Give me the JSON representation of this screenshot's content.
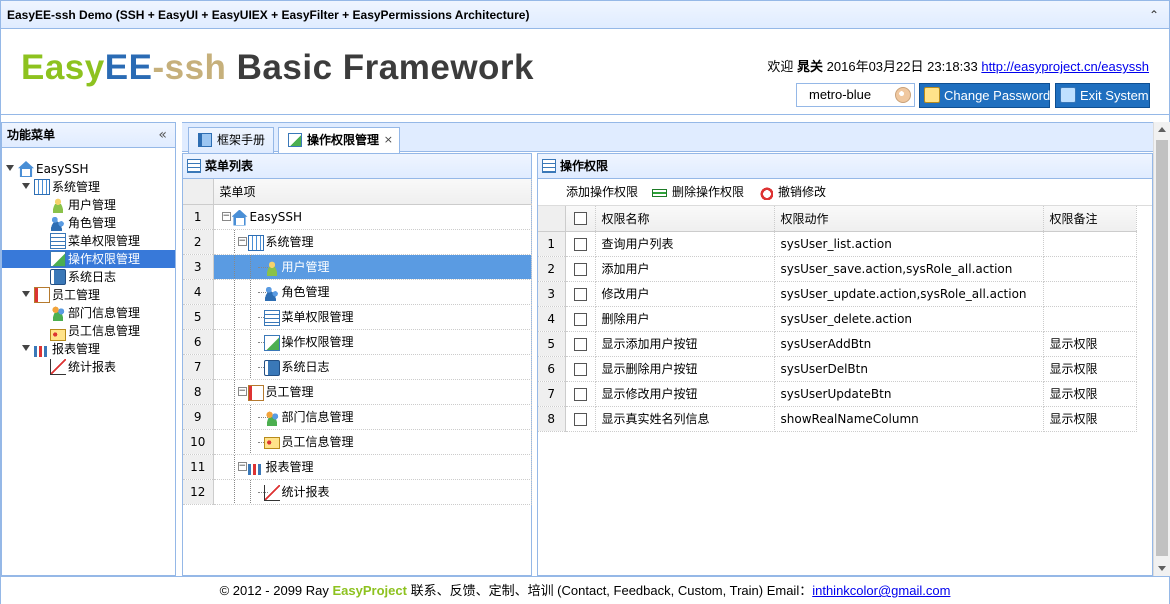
{
  "window": {
    "title": "EasyEE-ssh Demo (SSH + EasyUI + EasyUIEX + EasyFilter + EasyPermissions Architecture)"
  },
  "header": {
    "brand": {
      "part1": "Easy",
      "part2": "EE",
      "part3": "-ssh",
      "part4": " Basic Framework"
    },
    "welcome_prefix": "欢迎",
    "user": "晁关",
    "datetime": "2016年03月22日 23:18:33",
    "site_link": "http://easyproject.cn/easyssh",
    "theme_value": "metro-blue",
    "change_password_label": "Change Password",
    "exit_label": "Exit System"
  },
  "west": {
    "title": "功能菜单",
    "tree": [
      {
        "label": "EasySSH",
        "icon": "home-icon",
        "level": 0
      },
      {
        "label": "系统管理",
        "icon": "grid-icon",
        "level": 1
      },
      {
        "label": "用户管理",
        "icon": "user-icon",
        "level": 2
      },
      {
        "label": "角色管理",
        "icon": "role-icon",
        "level": 2
      },
      {
        "label": "菜单权限管理",
        "icon": "menu-icon",
        "level": 2
      },
      {
        "label": "操作权限管理",
        "icon": "permission-icon",
        "level": 2,
        "selected": true
      },
      {
        "label": "系统日志",
        "icon": "log-icon",
        "level": 2
      },
      {
        "label": "员工管理",
        "icon": "employee-icon",
        "level": 1
      },
      {
        "label": "部门信息管理",
        "icon": "department-icon",
        "level": 2
      },
      {
        "label": "员工信息管理",
        "icon": "card-icon",
        "level": 2
      },
      {
        "label": "报表管理",
        "icon": "chart-icon",
        "level": 1
      },
      {
        "label": "统计报表",
        "icon": "statistics-icon",
        "level": 2
      }
    ]
  },
  "tabs": [
    {
      "label": "框架手册",
      "icon": "book-icon",
      "active": false
    },
    {
      "label": "操作权限管理",
      "icon": "permission-icon",
      "active": true,
      "close": "×"
    }
  ],
  "menu_panel": {
    "title": "菜单列表",
    "column": "菜单项",
    "rows": [
      {
        "n": "1",
        "label": "EasySSH",
        "depth": 0,
        "icon": "home-icon",
        "toggle": "−"
      },
      {
        "n": "2",
        "label": "系统管理",
        "depth": 1,
        "icon": "grid-icon",
        "toggle": "−"
      },
      {
        "n": "3",
        "label": "用户管理",
        "depth": 2,
        "icon": "user-icon",
        "selected": true
      },
      {
        "n": "4",
        "label": "角色管理",
        "depth": 2,
        "icon": "role-icon"
      },
      {
        "n": "5",
        "label": "菜单权限管理",
        "depth": 2,
        "icon": "menu-icon"
      },
      {
        "n": "6",
        "label": "操作权限管理",
        "depth": 2,
        "icon": "permission-icon"
      },
      {
        "n": "7",
        "label": "系统日志",
        "depth": 2,
        "icon": "log-icon"
      },
      {
        "n": "8",
        "label": "员工管理",
        "depth": 1,
        "icon": "employee-icon",
        "toggle": "−"
      },
      {
        "n": "9",
        "label": "部门信息管理",
        "depth": 2,
        "icon": "department-icon"
      },
      {
        "n": "10",
        "label": "员工信息管理",
        "depth": 2,
        "icon": "card-icon"
      },
      {
        "n": "11",
        "label": "报表管理",
        "depth": 1,
        "icon": "chart-icon",
        "toggle": "−"
      },
      {
        "n": "12",
        "label": "统计报表",
        "depth": 2,
        "icon": "statistics-icon"
      }
    ]
  },
  "perm_panel": {
    "title": "操作权限",
    "toolbar": {
      "add": "添加操作权限",
      "delete": "删除操作权限",
      "undo": "撤销修改"
    },
    "columns": {
      "name": "权限名称",
      "action": "权限动作",
      "remark": "权限备注"
    },
    "rows": [
      {
        "n": "1",
        "name": "查询用户列表",
        "action": "sysUser_list.action",
        "remark": ""
      },
      {
        "n": "2",
        "name": "添加用户",
        "action": "sysUser_save.action,sysRole_all.action",
        "remark": ""
      },
      {
        "n": "3",
        "name": "修改用户",
        "action": "sysUser_update.action,sysRole_all.action",
        "remark": ""
      },
      {
        "n": "4",
        "name": "删除用户",
        "action": "sysUser_delete.action",
        "remark": ""
      },
      {
        "n": "5",
        "name": "显示添加用户按钮",
        "action": "sysUserAddBtn",
        "remark": "显示权限"
      },
      {
        "n": "6",
        "name": "显示删除用户按钮",
        "action": "sysUserDelBtn",
        "remark": "显示权限"
      },
      {
        "n": "7",
        "name": "显示修改用户按钮",
        "action": "sysUserUpdateBtn",
        "remark": "显示权限"
      },
      {
        "n": "8",
        "name": "显示真实姓名列信息",
        "action": "showRealNameColumn",
        "remark": "显示权限"
      }
    ]
  },
  "footer": {
    "prefix": "© 2012 - 2099 Ray ",
    "brand": "EasyProject",
    "middle": " 联系、反馈、定制、培训 (Contact, Feedback, Custom, Train) Email：",
    "email": "inthinkcolor@gmail.com"
  },
  "colors": {
    "accent": "#95b8e7",
    "selection": "#3879d9",
    "brand_green": "#8dc21f",
    "brand_blue": "#2a6bb4"
  }
}
